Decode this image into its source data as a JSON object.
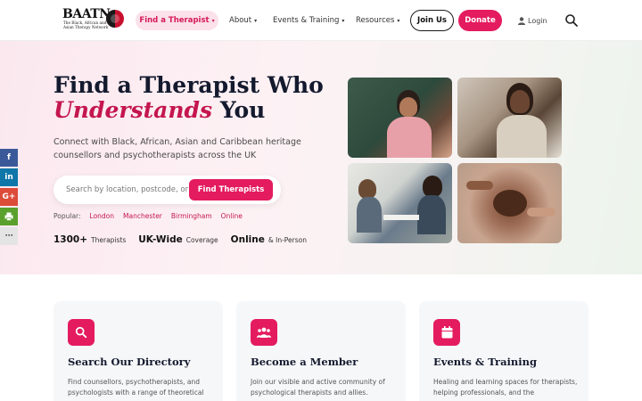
{
  "brand": {
    "logo_text": "BAATN",
    "logo_subtitle": "The Black, African and Asian Therapy Network"
  },
  "nav": {
    "find_therapist": "Find a Therapist",
    "about": "About",
    "events": "Events & Training",
    "resources": "Resources",
    "join": "Join Us",
    "donate": "Donate",
    "login": "Login"
  },
  "hero": {
    "title_line1": "Find a Therapist Who",
    "title_em": "Understands",
    "title_end": "You",
    "description": "Connect with Black, African, Asian and Caribbean heritage counsellors and psychotherapists across the UK",
    "search_placeholder": "Search by location, postcode, or",
    "search_button": "Find Therapists",
    "popular_label": "Popular:",
    "popular_tags": [
      "London",
      "Manchester",
      "Birmingham",
      "Online"
    ],
    "stats": [
      {
        "value": "1300+",
        "label": "Therapists"
      },
      {
        "value": "UK-Wide",
        "label": "Coverage"
      },
      {
        "value": "Online",
        "label": "& In-Person"
      }
    ]
  },
  "cards": [
    {
      "title": "Search Our Directory",
      "icon": "search-icon",
      "desc": "Find counsellors, psychotherapists, and psychologists with a range of theoretical"
    },
    {
      "title": "Become a Member",
      "icon": "users-icon",
      "desc": "Join our visible and active community of psychological therapists and allies."
    },
    {
      "title": "Events & Training",
      "icon": "calendar-icon",
      "desc": "Healing and learning spaces for therapists, helping professionals, and the"
    }
  ],
  "colors": {
    "accent": "#e41b5f",
    "title": "#141a2e"
  }
}
